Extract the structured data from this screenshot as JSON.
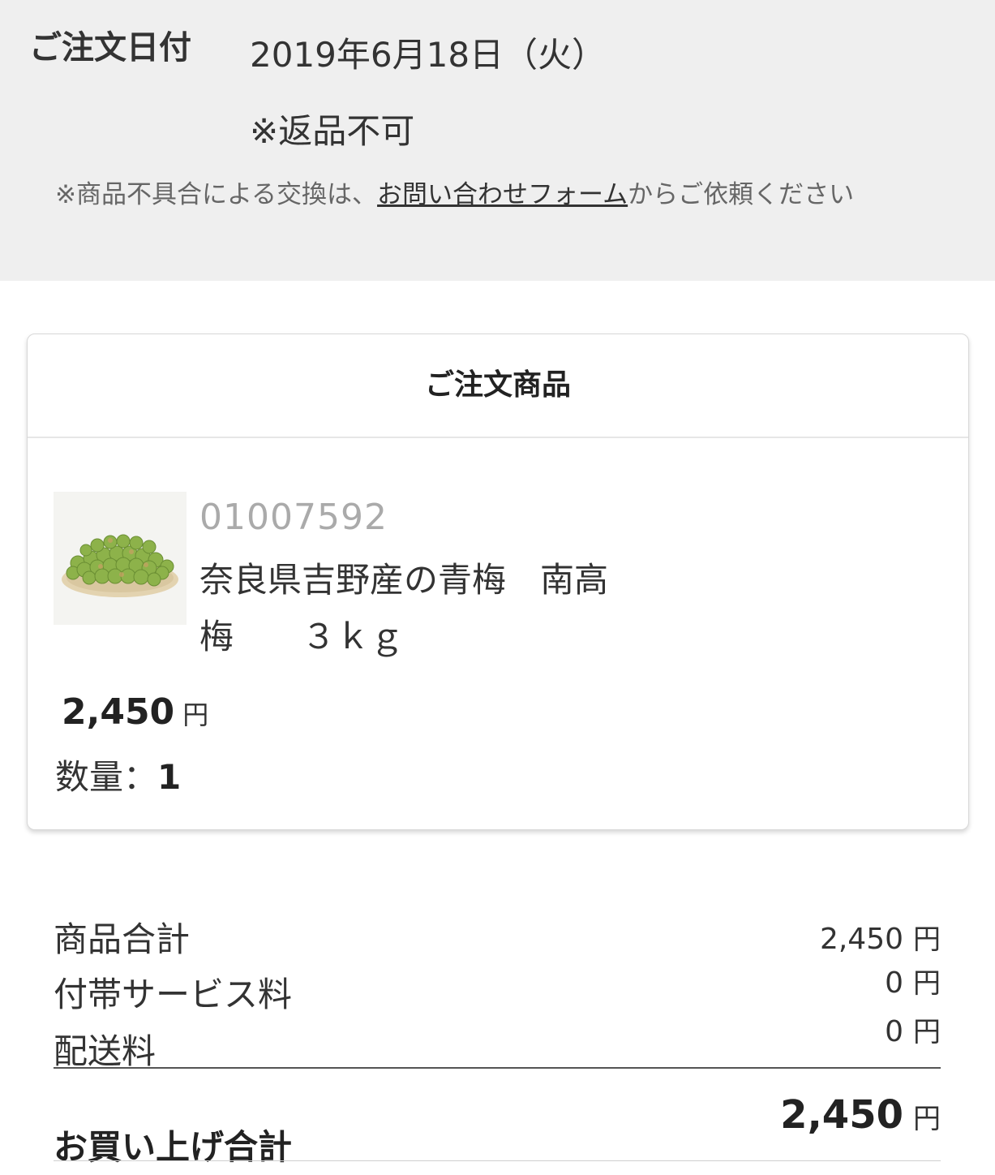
{
  "order_info": {
    "date_label": "ご注文日付",
    "date_value": "2019年6月18日（火）",
    "no_return": "※返品不可",
    "exchange_prefix": "※商品不具合による交換は、",
    "exchange_link": "お問い合わせフォーム",
    "exchange_suffix": "からご依頼ください"
  },
  "product_card": {
    "title": "ご注文商品",
    "item": {
      "thumbnail": "green-ume-plums-on-plate",
      "code": "01007592",
      "name": "奈良県吉野産の青梅　南高\n梅　　３ｋｇ",
      "price": "2,450",
      "price_unit": "円",
      "quantity_label": "数量：",
      "quantity": "1"
    }
  },
  "summary": {
    "rows": [
      {
        "label": "商品合計",
        "value": "2,450",
        "unit": "円"
      },
      {
        "label": "付帯サービス料",
        "value": "0",
        "unit": "円"
      },
      {
        "label": "配送料",
        "value": "0",
        "unit": "円"
      }
    ],
    "total_label": "お買い上げ合計",
    "total_value": "2,450",
    "total_unit": "円"
  }
}
